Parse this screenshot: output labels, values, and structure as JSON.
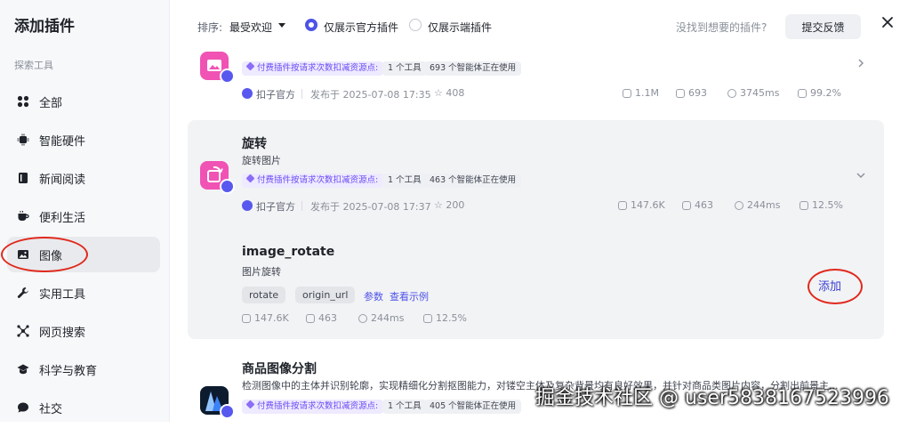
{
  "sidebar": {
    "title": "添加插件",
    "section_label": "探索工具",
    "items": [
      {
        "label": "全部",
        "icon": "grid-icon"
      },
      {
        "label": "智能硬件",
        "icon": "chip-icon"
      },
      {
        "label": "新闻阅读",
        "icon": "book-icon"
      },
      {
        "label": "便利生活",
        "icon": "coffee-icon"
      },
      {
        "label": "图像",
        "icon": "image-icon",
        "active": true
      },
      {
        "label": "实用工具",
        "icon": "wrench-icon"
      },
      {
        "label": "网页搜索",
        "icon": "network-icon"
      },
      {
        "label": "科学与教育",
        "icon": "graduation-cap-icon"
      },
      {
        "label": "社交",
        "icon": "chat-icon"
      }
    ]
  },
  "topbar": {
    "sort_label": "排序:",
    "sort_value": "最受欢迎",
    "filter_official": "仅展示官方插件",
    "filter_client": "仅展示端插件",
    "official_selected": true,
    "hint": "没找到想要的插件?",
    "feedback": "提交反馈"
  },
  "plugins": [
    {
      "paid_tag": "付费插件按请求次数扣减资源点",
      "tools_tag": "1 个工具",
      "agents_tag": "693 个智能体正在使用",
      "author": "扣子官方",
      "published": "发布于 2025-07-08 17:35",
      "favorites": "408",
      "stats": {
        "calls": "1.1M",
        "bots": "693",
        "latency": "3745ms",
        "success": "99.2%"
      }
    },
    {
      "name": "旋转",
      "desc": "旋转图片",
      "paid_tag": "付费插件按请求次数扣减资源点",
      "tools_tag": "1 个工具",
      "agents_tag": "463 个智能体正在使用",
      "author": "扣子官方",
      "published": "发布于 2025-07-08 17:37",
      "favorites": "200",
      "stats": {
        "calls": "147.6K",
        "bots": "463",
        "latency": "244ms",
        "success": "12.5%"
      },
      "tool": {
        "name": "image_rotate",
        "desc": "图片旋转",
        "params": [
          "rotate",
          "origin_url"
        ],
        "params_link": "参数",
        "example_link": "查看示例",
        "add_label": "添加",
        "stats": {
          "calls": "147.6K",
          "bots": "463",
          "latency": "244ms",
          "success": "12.5%"
        }
      }
    },
    {
      "name": "商品图像分割",
      "desc": "检测图像中的主体并识别轮廓，实现精细化分割抠图能力，对镂空主体及复杂背景均有良好效果，并针对商品类图片内容，分割出前景主...",
      "paid_tag": "付费插件按请求次数扣减资源点",
      "tools_tag": "1 个工具",
      "agents_tag": "405 个智能体正在使用"
    }
  ],
  "watermark": "掘金技术社区 @ user5838167523996",
  "colors": {
    "accent": "#4d53e8",
    "highlight_ring": "#e0291c",
    "paid_tag_bg": "#eeeaff"
  }
}
